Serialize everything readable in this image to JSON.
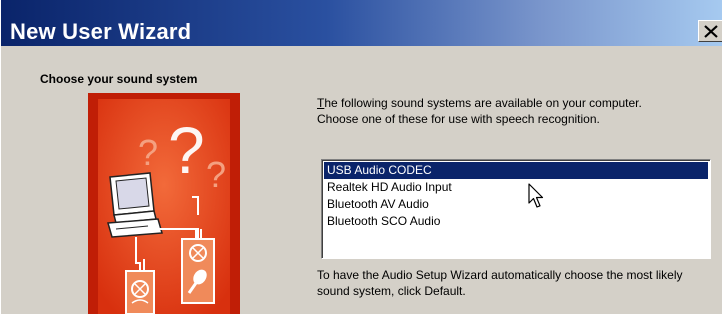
{
  "window": {
    "title": "New User Wizard",
    "close_symbol": "✕"
  },
  "page": {
    "heading": "Choose your sound system",
    "description_mnemonic": "T",
    "description_rest": "he following sound systems are available on your computer. Choose one of these for use with speech recognition.",
    "hint": "To have the Audio Setup Wizard automatically choose the most likely sound system, click Default."
  },
  "sound_systems": {
    "items": [
      "USB Audio CODEC",
      "Realtek HD Audio Input",
      "Bluetooth AV Audio",
      "Bluetooth SCO Audio"
    ],
    "selected_index": 0
  },
  "illustration": {
    "question_marks": [
      "?",
      "?",
      "?"
    ],
    "icons": [
      "computer-icon",
      "speaker-icon",
      "microphone-icon"
    ]
  },
  "colors": {
    "title_gradient_start": "#0a246a",
    "title_gradient_end": "#a6caf0",
    "selection": "#0a246a",
    "illustration_red": "#e8401c",
    "face": "#d4d0c8"
  }
}
